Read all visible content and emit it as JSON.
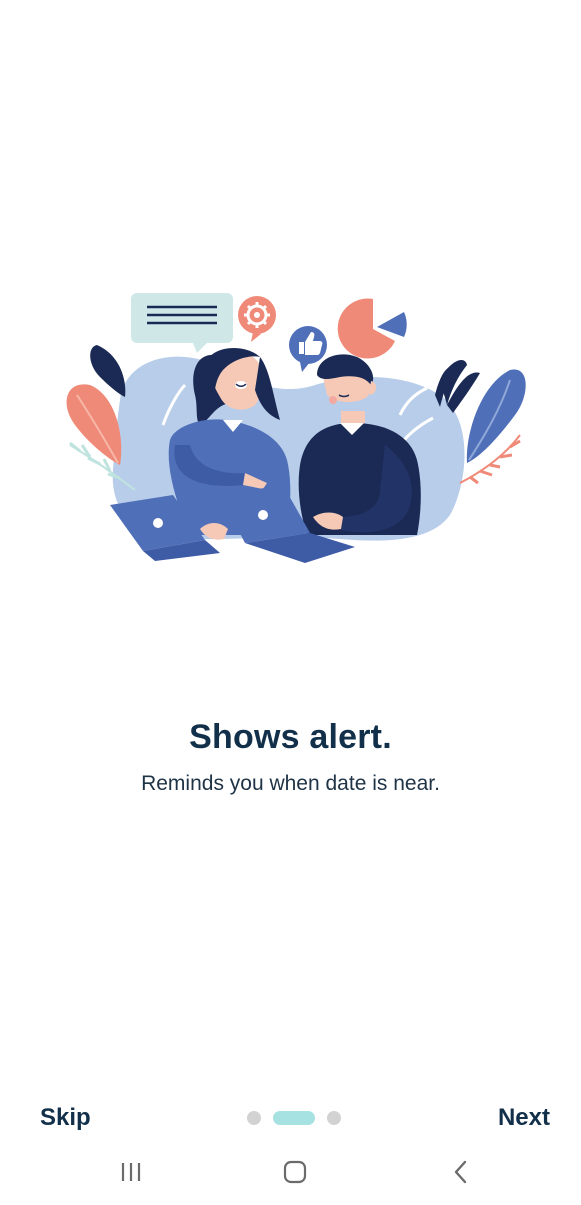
{
  "onboarding": {
    "title": "Shows alert.",
    "subtitle": "Reminds you when date is near.",
    "illustration_icon": "two-people-with-laptops-illustration"
  },
  "footer": {
    "skip_label": "Skip",
    "next_label": "Next",
    "page_count": 3,
    "current_page": 2
  },
  "system_nav": {
    "recents_icon": "recents-icon",
    "home_icon": "home-icon",
    "back_icon": "back-icon"
  },
  "colors": {
    "text_primary": "#13304a",
    "pager_active": "#a7e2e3",
    "pager_inactive": "#d2d2d2",
    "accent_coral": "#f08a78",
    "accent_blue": "#4f6fb8",
    "accent_navy": "#1b2a55"
  }
}
